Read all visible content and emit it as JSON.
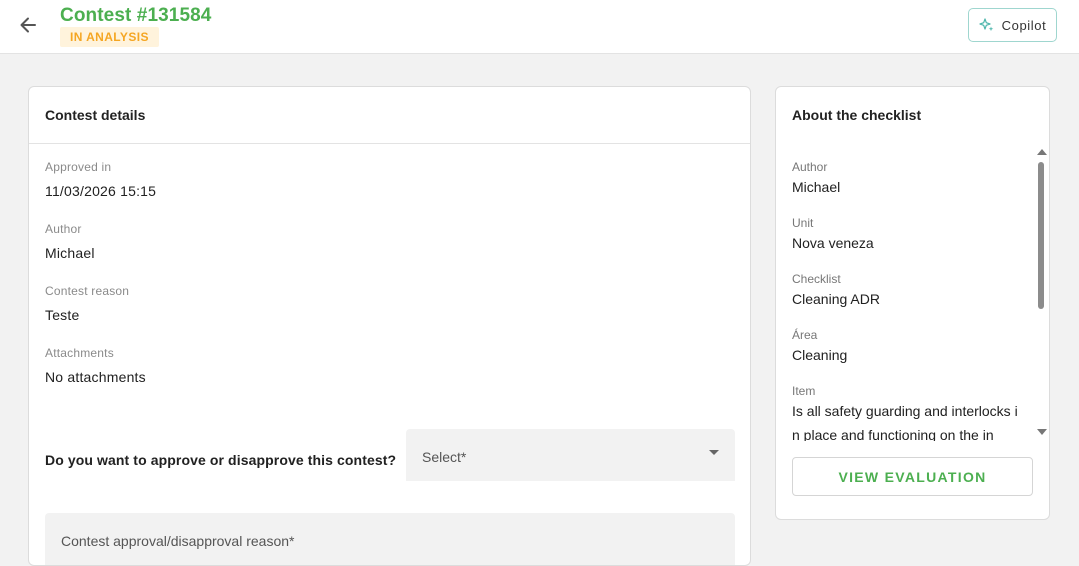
{
  "header": {
    "title": "Contest #131584",
    "status": "IN ANALYSIS",
    "copilot_label": "Copilot"
  },
  "details": {
    "title": "Contest details",
    "fields": [
      {
        "label": "Approved in",
        "value": "11/03/2026 15:15"
      },
      {
        "label": "Author",
        "value": "Michael"
      },
      {
        "label": "Contest reason",
        "value": "Teste"
      },
      {
        "label": "Attachments",
        "value": "No attachments"
      }
    ],
    "question": "Do you want to approve or disapprove this contest?",
    "select_placeholder": "Select*",
    "reason_placeholder": "Contest approval/disapproval reason*"
  },
  "checklist": {
    "title": "About the checklist",
    "fields": [
      {
        "label": "Author",
        "value": "Michael"
      },
      {
        "label": "Unit",
        "value": "Nova veneza"
      },
      {
        "label": "Checklist",
        "value": "Cleaning ADR"
      },
      {
        "label": "Área",
        "value": "Cleaning"
      },
      {
        "label": "Item",
        "value": "Is all safety guarding and interlocks in place and functioning on the in"
      }
    ],
    "view_button": "VIEW EVALUATION"
  },
  "colors": {
    "accent": "#4caf50",
    "status_bg": "#fff3dc",
    "status_fg": "#f5a623"
  }
}
